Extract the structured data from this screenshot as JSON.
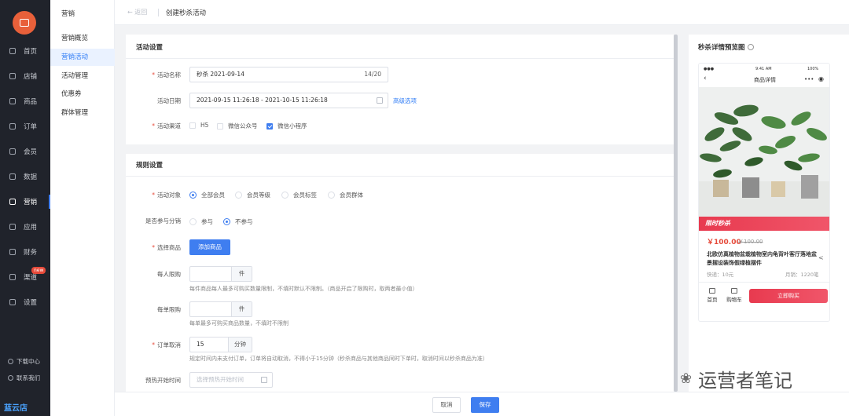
{
  "nav": {
    "items": [
      {
        "label": "首页",
        "icon": "home-icon"
      },
      {
        "label": "店铺",
        "icon": "store-icon"
      },
      {
        "label": "商品",
        "icon": "goods-icon"
      },
      {
        "label": "订单",
        "icon": "order-icon"
      },
      {
        "label": "会员",
        "icon": "member-icon"
      },
      {
        "label": "数据",
        "icon": "data-icon"
      },
      {
        "label": "营销",
        "icon": "marketing-icon"
      },
      {
        "label": "应用",
        "icon": "app-icon"
      },
      {
        "label": "财务",
        "icon": "finance-icon"
      },
      {
        "label": "渠道",
        "icon": "channel-icon"
      },
      {
        "label": "设置",
        "icon": "settings-icon"
      }
    ],
    "active_index": 6,
    "new_badge": "new",
    "download_center": "下载中心",
    "contact_us": "联系我们",
    "brand": "蓝云店"
  },
  "subnav": {
    "title": "营销",
    "items": [
      "营销概览",
      "营销活动",
      "活动管理",
      "优惠券",
      "群体管理"
    ],
    "active_index": 1
  },
  "header": {
    "back": "← 返回",
    "title": "创建秒杀活动"
  },
  "activity": {
    "section_title": "活动设置",
    "name_label": "活动名称",
    "name_value": "秒杀 2021-09-14",
    "name_count": "14/20",
    "date_label": "活动日期",
    "date_value": "2021-09-15 11:26:18 - 2021-10-15 11:26:18",
    "advanced_link": "高级选项",
    "channel_label": "活动渠道",
    "channels": [
      {
        "label": "H5",
        "checked": false
      },
      {
        "label": "微信公众号",
        "checked": false
      },
      {
        "label": "微信小程序",
        "checked": true
      }
    ]
  },
  "rules": {
    "section_title": "规则设置",
    "target_label": "活动对象",
    "targets": [
      {
        "label": "全部会员",
        "checked": true
      },
      {
        "label": "会员等级",
        "checked": false
      },
      {
        "label": "会员标签",
        "checked": false
      },
      {
        "label": "会员群体",
        "checked": false
      }
    ],
    "distribution_label": "是否参与分销",
    "distribution_options": [
      {
        "label": "参与",
        "checked": false
      },
      {
        "label": "不参与",
        "checked": true
      }
    ],
    "goods_label": "选择商品",
    "add_goods_button": "添加商品",
    "per_person_label": "每人限购",
    "per_person_unit": "件",
    "per_person_hint": "每件商品每人最多可购买数量限制，不填时默认不限制。（商品开启了限购时，取两者最小值）",
    "per_order_label": "每单限购",
    "per_order_unit": "件",
    "per_order_hint": "每单最多可购买商品数量，不填时不限制",
    "cancel_label": "订单取消",
    "cancel_value": "15",
    "cancel_unit": "分钟",
    "cancel_hint": "规定时间内未支付订单，订单将自动取消，不得小于15分钟（秒杀商品与其他商品同时下单时，取消时间以秒杀商品为准）",
    "preheat_label": "预热开始时间",
    "preheat_placeholder": "选择预热开始时间"
  },
  "footer": {
    "cancel": "取消",
    "save": "保存"
  },
  "preview": {
    "title": "秒杀详情预览图",
    "status_time": "9:41 AM",
    "status_battery": "100%",
    "page_title": "商品详情",
    "flash_label": "限时秒杀",
    "price": "￥100.00",
    "original_price": "￥100.00",
    "product_name": "北欧仿真植物盆栽植物室内龟背叶客厅落地盆景摆设装饰假绿植摆件",
    "shipping": "快递：10元",
    "monthly_sales": "月销：1220笔",
    "tab_home": "首页",
    "tab_cart": "购物车",
    "buy_button": "立即购买"
  },
  "watermark": "运营者笔记",
  "colors": {
    "primary": "#3f7ef0",
    "nav_bg": "#20232b",
    "danger": "#e64a3a",
    "logo": "#e8603a"
  }
}
